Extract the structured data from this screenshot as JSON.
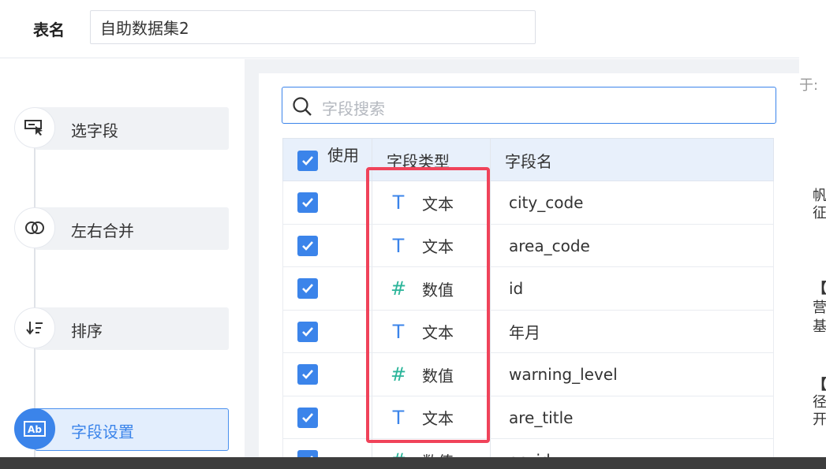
{
  "header": {
    "table_name_label": "表名",
    "table_name_value": "自助数据集2"
  },
  "steps": [
    {
      "label": "选字段",
      "icon": "select-field-icon"
    },
    {
      "label": "左右合并",
      "icon": "merge-icon"
    },
    {
      "label": "排序",
      "icon": "sort-icon"
    },
    {
      "label": "字段设置",
      "icon": "field-settings-icon",
      "active": true
    }
  ],
  "search": {
    "placeholder": "字段搜索"
  },
  "table": {
    "headers": {
      "use": "使用",
      "type": "字段类型",
      "name": "字段名"
    },
    "rows": [
      {
        "checked": true,
        "type_icon": "T",
        "type": "文本",
        "name": "city_code"
      },
      {
        "checked": true,
        "type_icon": "T",
        "type": "文本",
        "name": "area_code"
      },
      {
        "checked": true,
        "type_icon": "#",
        "type": "数值",
        "name": "id"
      },
      {
        "checked": true,
        "type_icon": "T",
        "type": "文本",
        "name": "年月"
      },
      {
        "checked": true,
        "type_icon": "#",
        "type": "数值",
        "name": "warning_level"
      },
      {
        "checked": true,
        "type_icon": "T",
        "type": "文本",
        "name": "are_title"
      },
      {
        "checked": true,
        "type_icon": "#",
        "type": "数值",
        "name": "ao_id"
      }
    ]
  },
  "side_text": {
    "t0": "于:",
    "t1": "帆",
    "t2": "征",
    "t3": "【",
    "t4": "营",
    "t5": "基",
    "t6": "【",
    "t7": "径",
    "t8": "开"
  },
  "colors": {
    "accent": "#3b84ea",
    "text_type": "#3b84ea",
    "number_type": "#2bb59a",
    "highlight": "#f0435a"
  }
}
